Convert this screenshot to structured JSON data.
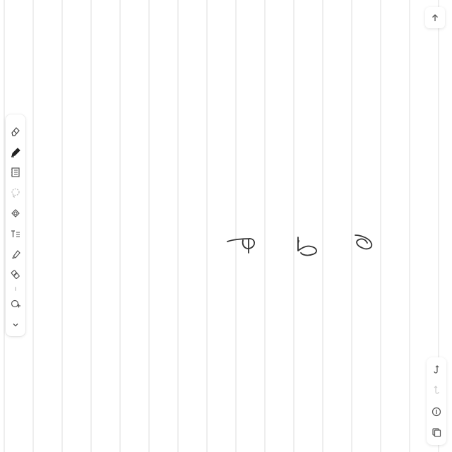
{
  "canvas": {
    "rule_color": "#dcdcdc",
    "ink_color": "#333333"
  },
  "toolbar": {
    "items": [
      {
        "name": "eraser-icon"
      },
      {
        "name": "pen-icon",
        "active": true
      },
      {
        "name": "notebook-icon"
      },
      {
        "name": "lasso-icon"
      },
      {
        "name": "shapes-icon"
      },
      {
        "name": "text-tool-icon"
      },
      {
        "name": "highlighter-icon"
      },
      {
        "name": "marker-icon"
      },
      {
        "name": "shape-add-icon"
      },
      {
        "name": "chevron-down-icon"
      }
    ]
  },
  "top_right": {
    "icon": "arrow-up-icon"
  },
  "bottom_right": {
    "items": [
      {
        "name": "undo-icon"
      },
      {
        "name": "redo-icon",
        "disabled": true
      },
      {
        "name": "info-icon"
      },
      {
        "name": "pages-icon"
      }
    ]
  }
}
